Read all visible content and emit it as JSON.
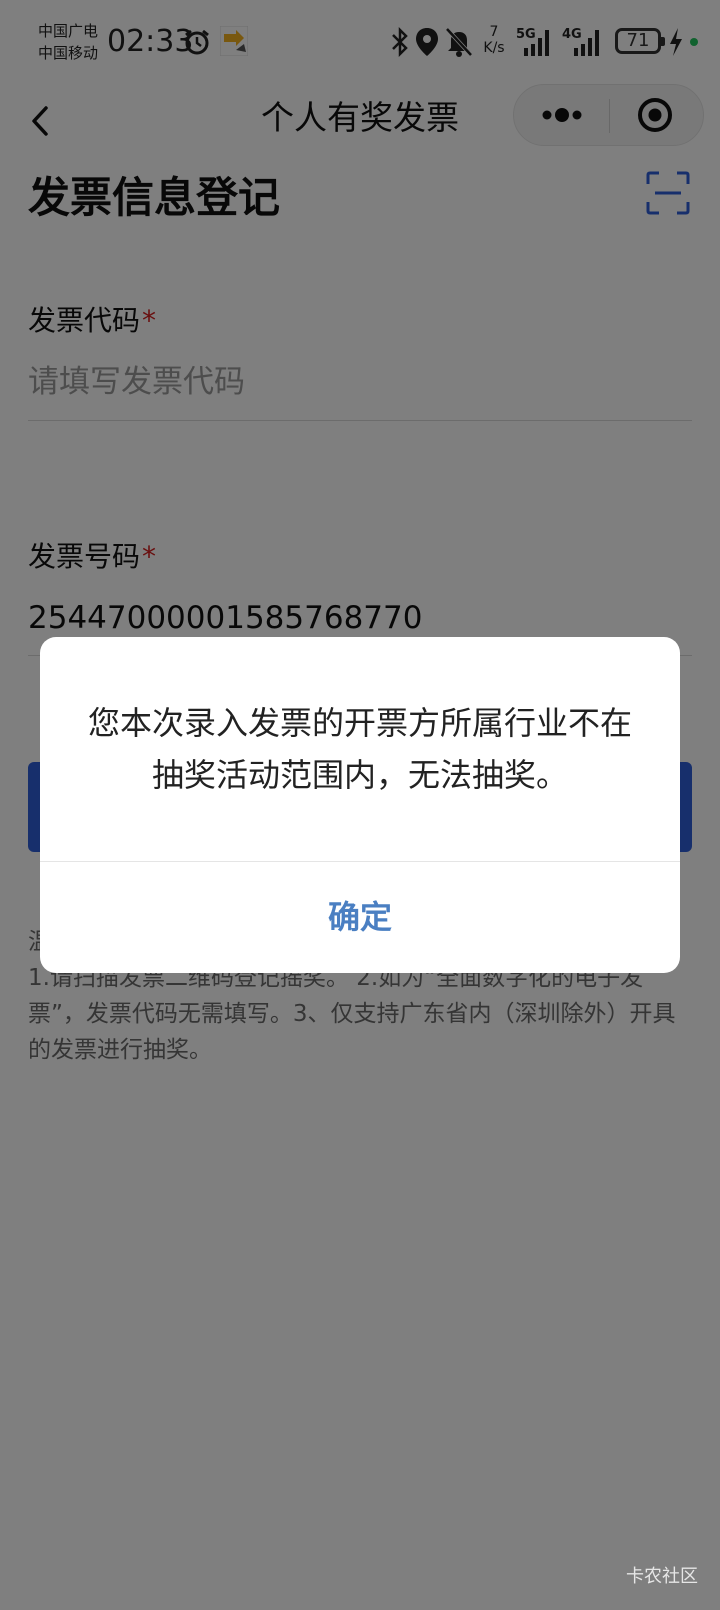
{
  "status_bar": {
    "carrier_1": "中国广电",
    "carrier_2": "中国移动",
    "time": "02:33",
    "net_speed_value": "7",
    "net_speed_unit": "K/s",
    "signal_1_label": "5G",
    "signal_2_label": "4G",
    "battery_level": "71",
    "icons": [
      "alarm-icon",
      "app-notification-icon",
      "bluetooth-icon",
      "location-icon",
      "mute-icon",
      "charging-icon"
    ]
  },
  "nav": {
    "title": "个人有奖发票"
  },
  "page": {
    "title": "发票信息登记",
    "invoice_code": {
      "label": "发票代码",
      "required_mark": "*",
      "placeholder": "请填写发票代码",
      "value": ""
    },
    "invoice_number": {
      "label": "发票号码",
      "required_mark": "*",
      "value": "25447000001585768770"
    },
    "notes": {
      "heading_fragment": "温",
      "text": "1.请扫描发票二维码登记摇奖。 2.如为“全面数字化的电子发票”，发票代码无需填写。3、仅支持广东省内（深圳除外）开具的发票进行抽奖。"
    }
  },
  "modal": {
    "message": "您本次录入发票的开票方所属行业不在抽奖活动范围内，无法抽奖。",
    "confirm_label": "确定"
  },
  "watermark": "卡农社区",
  "colors": {
    "accent": "#2f5fd8",
    "modal_button": "#4a7fc2",
    "required": "#d21f1f",
    "overlay": "rgba(0,0,0,0.5)"
  }
}
